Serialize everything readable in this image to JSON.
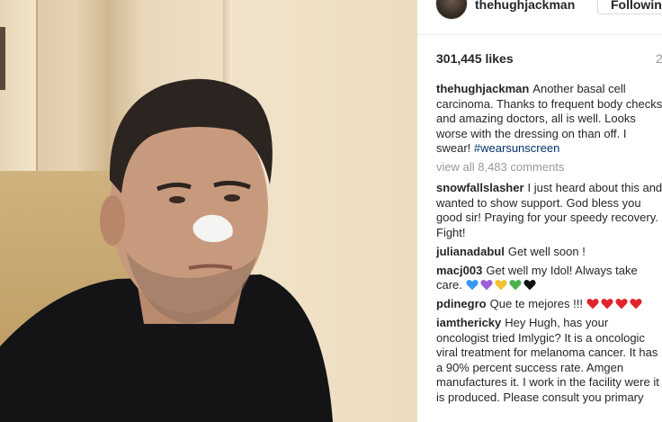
{
  "post": {
    "username": "thehughjackman",
    "follow_label": "Following",
    "likes": "301,445 likes",
    "age": "2",
    "caption_user": "thehughjackman",
    "caption_text": "Another basal cell carcinoma. Thanks to frequent body checks and amazing doctors, all is well. Looks worse with the dressing on than off. I swear!",
    "caption_hashtag": "#wearsunscreen",
    "view_all": "view all 8,483 comments"
  },
  "comments": [
    {
      "user": "snowfallslasher",
      "text": "I just heard about this and wanted to show support. God bless you good sir! Praying for your speedy recovery. Fight!"
    },
    {
      "user": "julianadabul",
      "text": "Get well soon !"
    },
    {
      "user": "macj003",
      "text": "Get well my Idol! Always take care."
    },
    {
      "user": "pdinegro",
      "text": "Que te mejores !!!"
    },
    {
      "user": "iamthericky",
      "text": "Hey Hugh, has your oncologist tried Imlygic? It is a oncologic viral treatment for melanoma cancer. It has a 90% percent success rate. Amgen manufactures it. I work in the facility were it is produced. Please consult you primary"
    }
  ],
  "emoji": {
    "macj003_hearts": [
      "#3897f0",
      "#a05fd6",
      "#f2c230",
      "#4caf50",
      "#111111"
    ],
    "pdinegro_hearts": [
      "#e0242c",
      "#e0242c",
      "#e0242c",
      "#e0242c"
    ]
  },
  "icons": {
    "avatar": "profile-photo",
    "heart": "heart-emoji"
  }
}
